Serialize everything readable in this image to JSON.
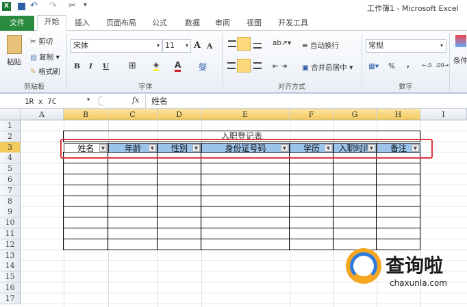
{
  "window": {
    "title": "工作簿1 - Microsoft Excel"
  },
  "tabs": [
    {
      "label": "文件"
    },
    {
      "label": "开始"
    },
    {
      "label": "插入"
    },
    {
      "label": "页面布局"
    },
    {
      "label": "公式"
    },
    {
      "label": "数据"
    },
    {
      "label": "审阅"
    },
    {
      "label": "视图"
    },
    {
      "label": "开发工具"
    }
  ],
  "ribbon": {
    "clipboard": {
      "paste": "粘贴",
      "cut": "剪切",
      "copy": "复制",
      "format_painter": "格式刷",
      "label": "剪贴板"
    },
    "font": {
      "name": "宋体",
      "size": "11",
      "bold": "B",
      "italic": "I",
      "underline": "U",
      "label": "字体"
    },
    "alignment": {
      "wrap": "自动换行",
      "merge": "合并后居中",
      "label": "对齐方式"
    },
    "number": {
      "format": "常规",
      "percent": "%",
      "comma": ",",
      "label": "数字"
    },
    "styles": {
      "conditional": "条件"
    }
  },
  "formula_bar": {
    "name_box": "1R x 7C",
    "fx": "fx",
    "value": "姓名"
  },
  "columns": [
    "A",
    "B",
    "C",
    "D",
    "E",
    "F",
    "G",
    "H",
    "I"
  ],
  "rows": [
    "1",
    "2",
    "3",
    "4",
    "5",
    "6",
    "7",
    "8",
    "9",
    "10",
    "11",
    "12",
    "13",
    "14",
    "15",
    "16",
    "17"
  ],
  "sheet": {
    "title": "入职登记表",
    "headers": [
      "姓名",
      "年龄",
      "性别",
      "身份证号码",
      "学历",
      "入职时间",
      "备注"
    ]
  },
  "highlight_color": "#e0343c",
  "watermark": {
    "text": "查询啦",
    "url": "chaxunla.com"
  }
}
